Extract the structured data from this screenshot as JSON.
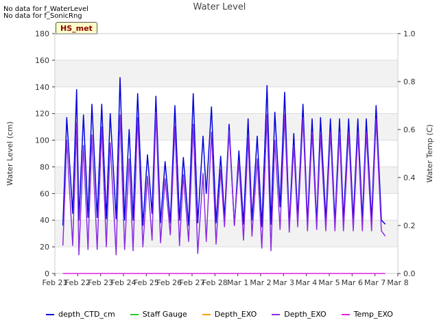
{
  "notices": [
    "No data for f_WaterLevel",
    "No data for f_SonicRng"
  ],
  "badge": "HS_met",
  "chart_data": {
    "type": "line",
    "title": "Water Level",
    "ylabel": "Water Level (cm)",
    "y2label": "Water Temp (C)",
    "ylim": [
      0,
      180
    ],
    "y2lim": [
      0.0,
      1.0
    ],
    "xlim": [
      "2025-02-21",
      "2025-03-08"
    ],
    "y_ticks": [
      0,
      20,
      40,
      60,
      80,
      100,
      120,
      140,
      160,
      180
    ],
    "y2_ticks": [
      "0.0",
      "0.2",
      "0.4",
      "0.6",
      "0.8",
      "1.0"
    ],
    "x_ticks": [
      "Feb 21",
      "Feb 22",
      "Feb 23",
      "Feb 24",
      "Feb 25",
      "Feb 26",
      "Feb 27",
      "Feb 28",
      "Mar 1",
      "Mar 2",
      "Mar 3",
      "Mar 4",
      "Mar 5",
      "Mar 6",
      "Mar 7",
      "Mar 8"
    ],
    "grid": true,
    "legend_position": "bottom",
    "series": [
      {
        "name": "depth_CTD_cm",
        "color": "#0000dd",
        "axis": "left",
        "x_days": [
          0.35,
          0.52,
          0.78,
          0.95,
          1.05,
          1.25,
          1.45,
          1.62,
          1.85,
          2.05,
          2.25,
          2.42,
          2.68,
          2.85,
          3.05,
          3.25,
          3.42,
          3.62,
          3.85,
          4.05,
          4.25,
          4.42,
          4.62,
          4.82,
          5.05,
          5.25,
          5.45,
          5.62,
          5.85,
          6.05,
          6.25,
          6.48,
          6.62,
          6.85,
          7.05,
          7.25,
          7.42,
          7.62,
          7.85,
          8.05,
          8.25,
          8.45,
          8.62,
          8.85,
          9.05,
          9.28,
          9.45,
          9.62,
          9.85,
          10.05,
          10.25,
          10.45,
          10.62,
          10.85,
          11.05,
          11.25,
          11.45,
          11.62,
          11.85,
          12.05,
          12.25,
          12.45,
          12.62,
          12.85,
          13.05,
          13.25,
          13.45,
          13.62,
          13.85,
          14.05,
          14.28,
          14.45
        ],
        "y": [
          36,
          117,
          45,
          138,
          40,
          119,
          42,
          127,
          42,
          127,
          41,
          120,
          41,
          147,
          40,
          108,
          40,
          135,
          36,
          89,
          45,
          133,
          38,
          84,
          38,
          126,
          40,
          87,
          36,
          135,
          38,
          103,
          60,
          125,
          38,
          88,
          42,
          112,
          36,
          92,
          37,
          116,
          40,
          103,
          35,
          141,
          37,
          121,
          50,
          136,
          36,
          105,
          42,
          127,
          38,
          116,
          38,
          117,
          40,
          116,
          38,
          116,
          40,
          116,
          40,
          116,
          40,
          116,
          40,
          126,
          40,
          37
        ]
      },
      {
        "name": "Staff Gauge",
        "color": "#22cc22",
        "axis": "left",
        "x_days": [],
        "y": []
      },
      {
        "name": "Depth_EXO",
        "color": "#ff9900",
        "axis": "left",
        "x_days": [],
        "y": []
      },
      {
        "name": "Depth_EXO",
        "color": "#8a2be2",
        "axis": "left",
        "x_days": [
          0.35,
          0.52,
          0.78,
          0.95,
          1.05,
          1.25,
          1.45,
          1.62,
          1.85,
          2.05,
          2.25,
          2.42,
          2.68,
          2.85,
          3.05,
          3.25,
          3.42,
          3.62,
          3.85,
          4.05,
          4.25,
          4.42,
          4.62,
          4.82,
          5.05,
          5.25,
          5.45,
          5.62,
          5.85,
          6.05,
          6.25,
          6.48,
          6.62,
          6.85,
          7.05,
          7.25,
          7.42,
          7.62,
          7.85,
          8.05,
          8.25,
          8.45,
          8.62,
          8.85,
          9.05,
          9.28,
          9.45,
          9.62,
          9.85,
          10.05,
          10.25,
          10.45,
          10.62,
          10.85,
          11.05,
          11.25,
          11.45,
          11.62,
          11.85,
          12.05,
          12.25,
          12.45,
          12.62,
          12.85,
          13.05,
          13.25,
          13.45,
          13.62,
          13.85,
          14.05,
          14.28,
          14.45
        ],
        "y": [
          21,
          100,
          21,
          113,
          14,
          96,
          18,
          104,
          18,
          110,
          20,
          98,
          14,
          119,
          18,
          86,
          17,
          117,
          20,
          73,
          25,
          121,
          23,
          71,
          29,
          110,
          21,
          74,
          24,
          112,
          15,
          75,
          24,
          106,
          22,
          78,
          35,
          107,
          36,
          84,
          25,
          102,
          28,
          86,
          19,
          119,
          17,
          100,
          33,
          119,
          31,
          96,
          35,
          117,
          32,
          106,
          33,
          104,
          32,
          106,
          32,
          106,
          32,
          106,
          32,
          106,
          32,
          106,
          32,
          116,
          32,
          28
        ]
      },
      {
        "name": "Temp_EXO",
        "color": "#dd22dd",
        "axis": "right",
        "x_days": [
          0.35,
          14.45
        ],
        "y": [
          0.0,
          0.0
        ]
      }
    ]
  }
}
